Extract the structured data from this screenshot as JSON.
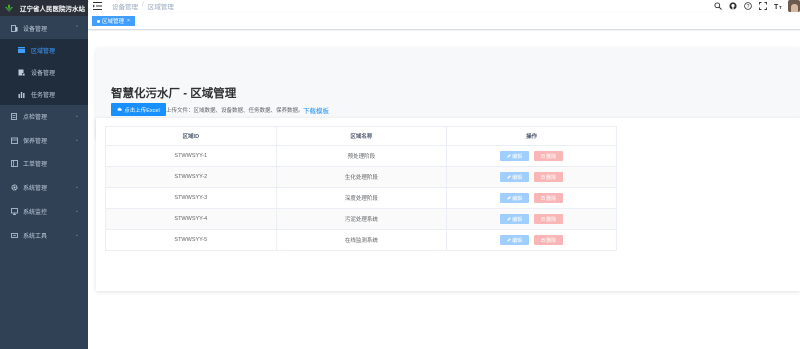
{
  "app": {
    "title": "辽宁省人民医院污水站"
  },
  "sidebar": {
    "items": [
      {
        "label": "设备管理",
        "icon": "device-icon",
        "expandable": true
      },
      {
        "label": "区域管理",
        "icon": "region-icon",
        "active": true
      },
      {
        "label": "设备管理",
        "icon": "equipment-icon"
      },
      {
        "label": "任务管理",
        "icon": "task-icon"
      },
      {
        "label": "点检管理",
        "icon": "inspection-icon",
        "expandable": true
      },
      {
        "label": "保养管理",
        "icon": "maintenance-icon",
        "expandable": true
      },
      {
        "label": "工单管理",
        "icon": "workorder-icon",
        "expandable": false
      },
      {
        "label": "系统管理",
        "icon": "gear-icon",
        "expandable": true
      },
      {
        "label": "系统监控",
        "icon": "monitor-icon",
        "expandable": true
      },
      {
        "label": "系统工具",
        "icon": "tool-icon",
        "expandable": true
      }
    ]
  },
  "navbar": {
    "breadcrumb": [
      "设备管理",
      "区域管理"
    ],
    "icons": [
      "search-icon",
      "github-icon",
      "question-icon",
      "fullscreen-icon",
      "font-size-icon"
    ]
  },
  "tags": {
    "active": "区域管理"
  },
  "page": {
    "title": "智慧化污水厂 - 区域管理",
    "upload_label": "点击上传Excel",
    "upload_hint": "上传文件：区域数据、设备数据、任务数据、保养数据。",
    "download_label": "下载模板"
  },
  "table": {
    "headers": [
      "区域ID",
      "区域名称",
      "操作"
    ],
    "rows": [
      {
        "id": "STWWSYY-1",
        "name": "预处理阶段"
      },
      {
        "id": "STWWSYY-2",
        "name": "生化处理阶段"
      },
      {
        "id": "STWWSYY-3",
        "name": "深度处理阶段"
      },
      {
        "id": "STWWSYY-4",
        "name": "污泥处理系统"
      },
      {
        "id": "STWWSYY-5",
        "name": "在线监测系统"
      }
    ],
    "edit_label": "编辑",
    "delete_label": "删除"
  },
  "colors": {
    "sidebar_bg": "#304156",
    "primary": "#1890ff",
    "active_text": "#409eff"
  }
}
